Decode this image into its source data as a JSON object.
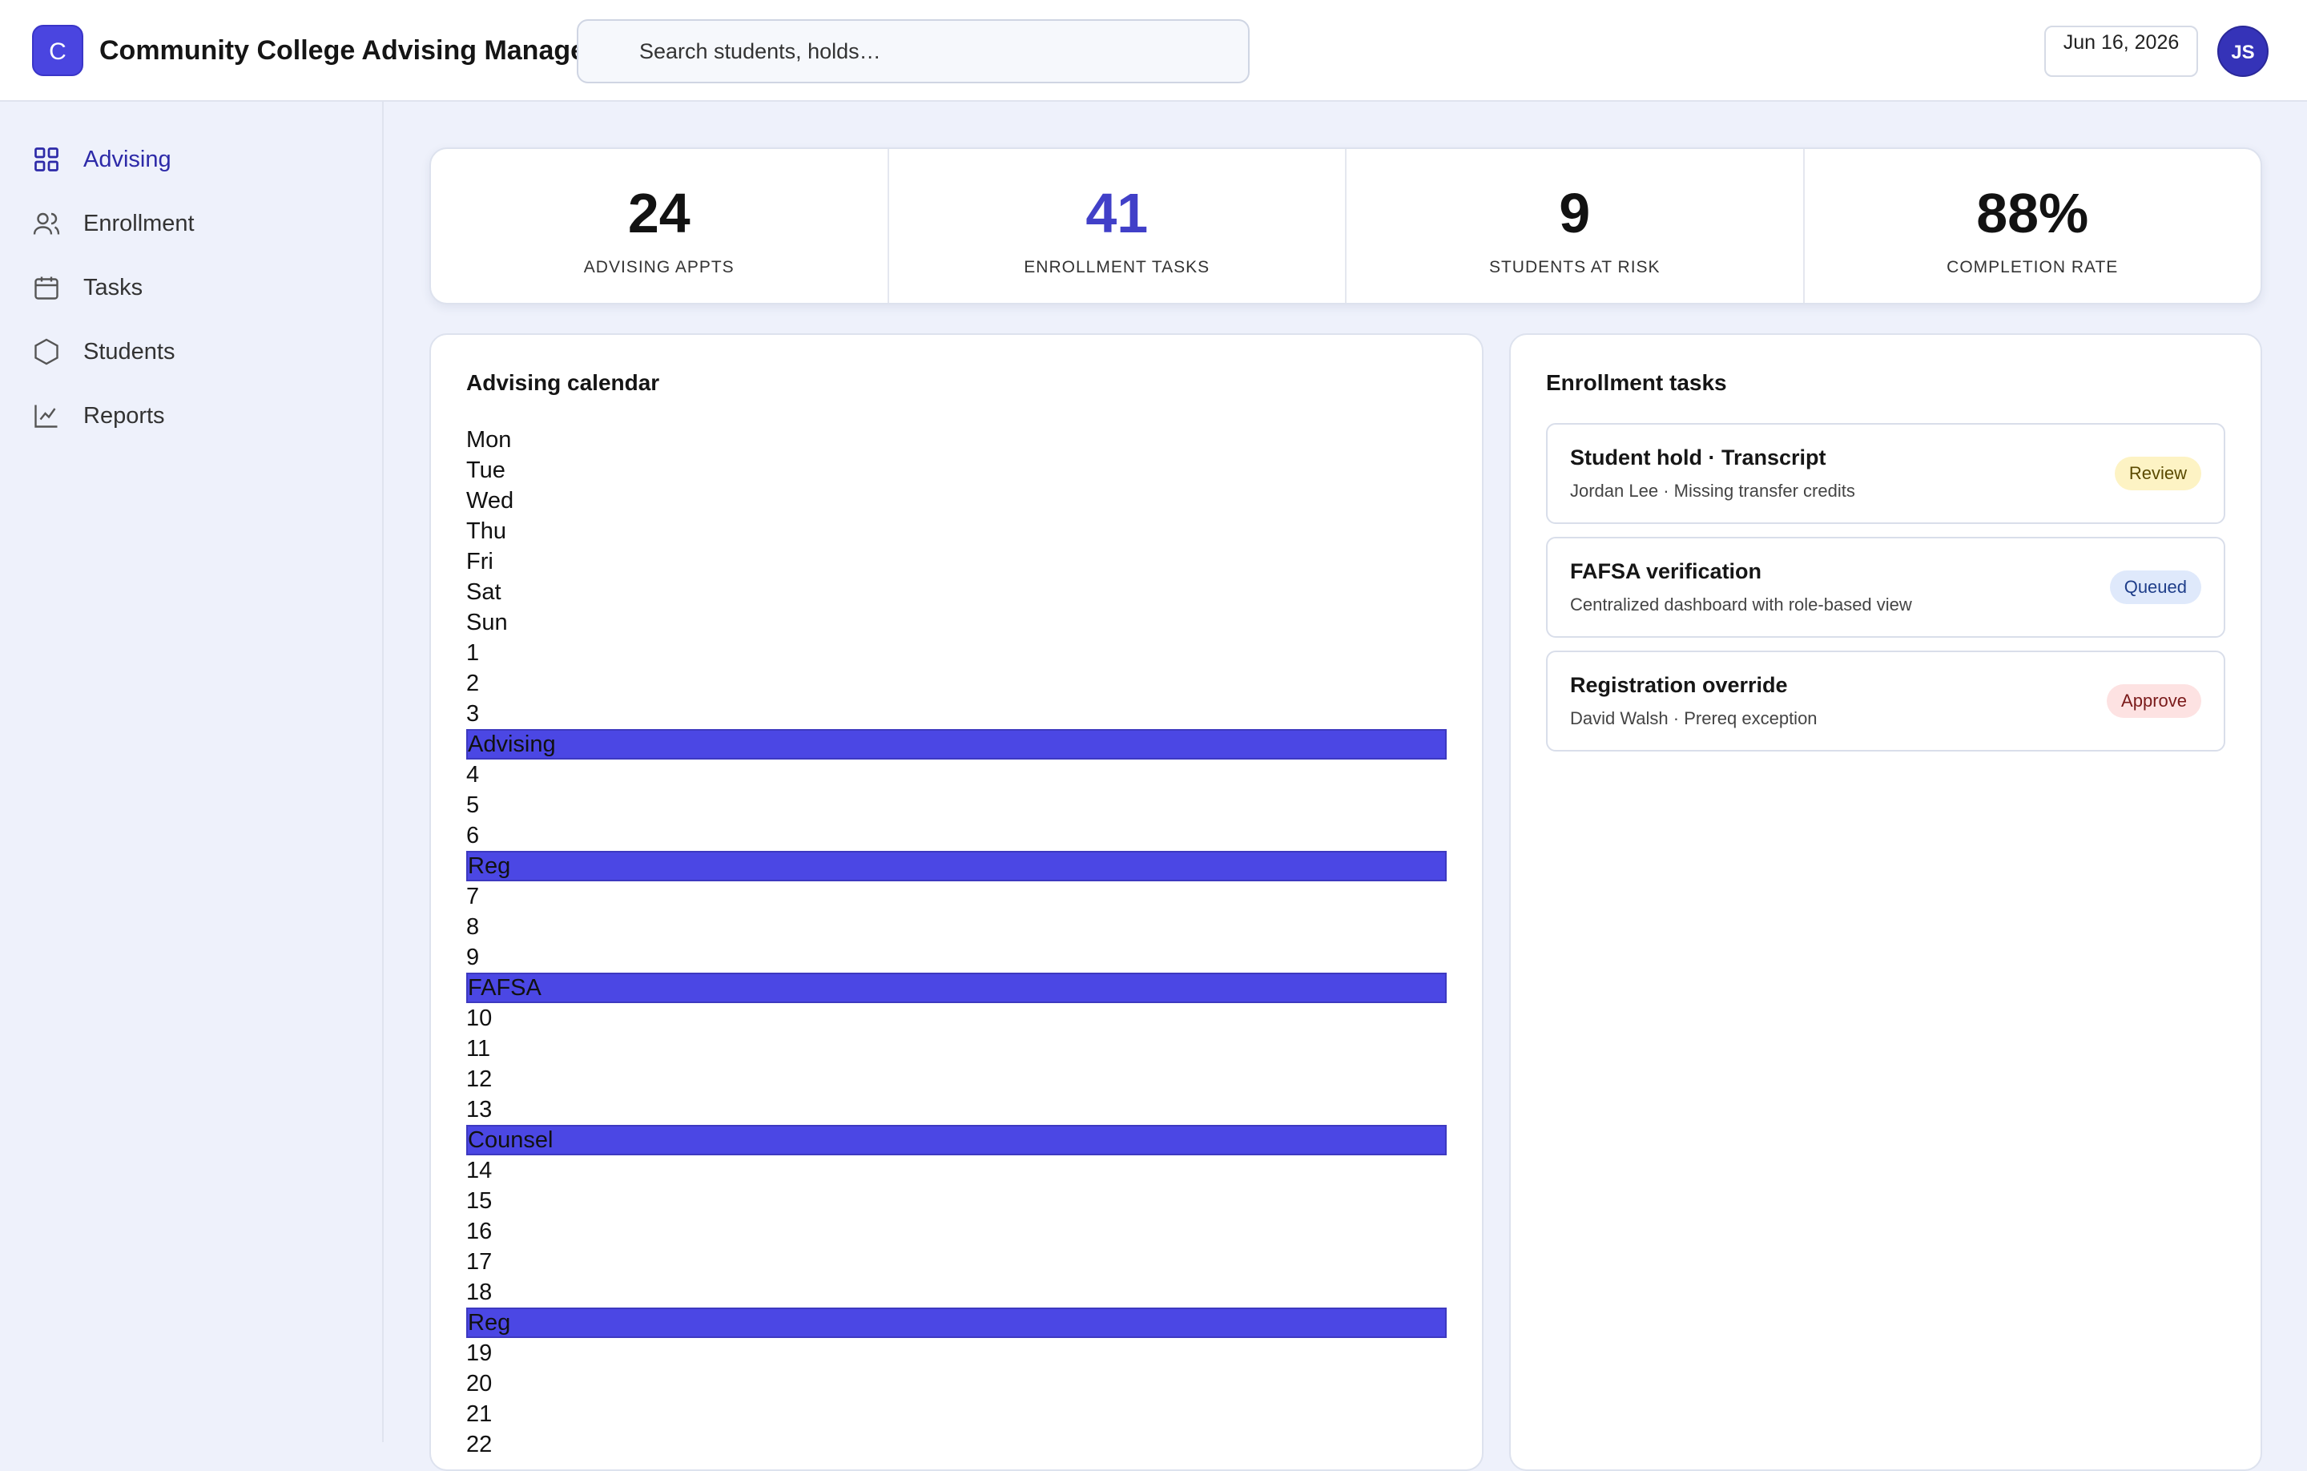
{
  "header": {
    "logo_letter": "C",
    "title": "Community College Advising Manager",
    "search_placeholder": "Search students, holds…",
    "date": "Jun 16, 2026",
    "avatar_initials": "JS"
  },
  "sidebar": {
    "items": [
      {
        "label": "Advising",
        "icon": "grid-icon",
        "active": true
      },
      {
        "label": "Enrollment",
        "icon": "users-icon",
        "active": false
      },
      {
        "label": "Tasks",
        "icon": "calendar-icon",
        "active": false
      },
      {
        "label": "Students",
        "icon": "hexagon-icon",
        "active": false
      },
      {
        "label": "Reports",
        "icon": "chart-icon",
        "active": false
      }
    ]
  },
  "stats": [
    {
      "value": "24",
      "label": "ADVISING APPTS"
    },
    {
      "value": "41",
      "label": "ENROLLMENT TASKS"
    },
    {
      "value": "9",
      "label": "STUDENTS AT RISK"
    },
    {
      "value": "88%",
      "label": "COMPLETION RATE"
    }
  ],
  "calendar": {
    "title": "Advising calendar",
    "rows": [
      {
        "text": "Mon",
        "event": false
      },
      {
        "text": "Tue",
        "event": false
      },
      {
        "text": "Wed",
        "event": false
      },
      {
        "text": "Thu",
        "event": false
      },
      {
        "text": "Fri",
        "event": false
      },
      {
        "text": "Sat",
        "event": false
      },
      {
        "text": "Sun",
        "event": false
      },
      {
        "text": "1",
        "event": false
      },
      {
        "text": "2",
        "event": false
      },
      {
        "text": "3",
        "event": false
      },
      {
        "text": "Advising",
        "event": true
      },
      {
        "text": "4",
        "event": false
      },
      {
        "text": "5",
        "event": false
      },
      {
        "text": "6",
        "event": false
      },
      {
        "text": "Reg",
        "event": true
      },
      {
        "text": "7",
        "event": false
      },
      {
        "text": "8",
        "event": false
      },
      {
        "text": "9",
        "event": false
      },
      {
        "text": "FAFSA",
        "event": true
      },
      {
        "text": "10",
        "event": false
      },
      {
        "text": "11",
        "event": false
      },
      {
        "text": "12",
        "event": false
      },
      {
        "text": "13",
        "event": false
      },
      {
        "text": "Counsel",
        "event": true
      },
      {
        "text": "14",
        "event": false
      },
      {
        "text": "15",
        "event": false
      },
      {
        "text": "16",
        "event": false
      },
      {
        "text": "17",
        "event": false
      },
      {
        "text": "18",
        "event": false
      },
      {
        "text": "Reg",
        "event": true
      },
      {
        "text": "19",
        "event": false
      },
      {
        "text": "20",
        "event": false
      },
      {
        "text": "21",
        "event": false
      },
      {
        "text": "22",
        "event": false
      }
    ]
  },
  "tasks": {
    "title": "Enrollment tasks",
    "items": [
      {
        "title": "Student hold · Transcript",
        "subtitle": "Jordan Lee · Missing transfer credits",
        "badge": "Review",
        "badge_bg": "#fdf3c4",
        "badge_fg": "#5a4a00"
      },
      {
        "title": "FAFSA verification",
        "subtitle": "Centralized dashboard with role-based view",
        "badge": "Queued",
        "badge_bg": "#dfe9fb",
        "badge_fg": "#1f3e8a"
      },
      {
        "title": "Registration override",
        "subtitle": "David Walsh · Prereq exception",
        "badge": "Approve",
        "badge_bg": "#fde2e2",
        "badge_fg": "#7a1a1a"
      }
    ]
  },
  "colors": {
    "accent": "#4a45e0",
    "event_bar": "#4b47e4",
    "active_nav": "#2d2aa8"
  }
}
